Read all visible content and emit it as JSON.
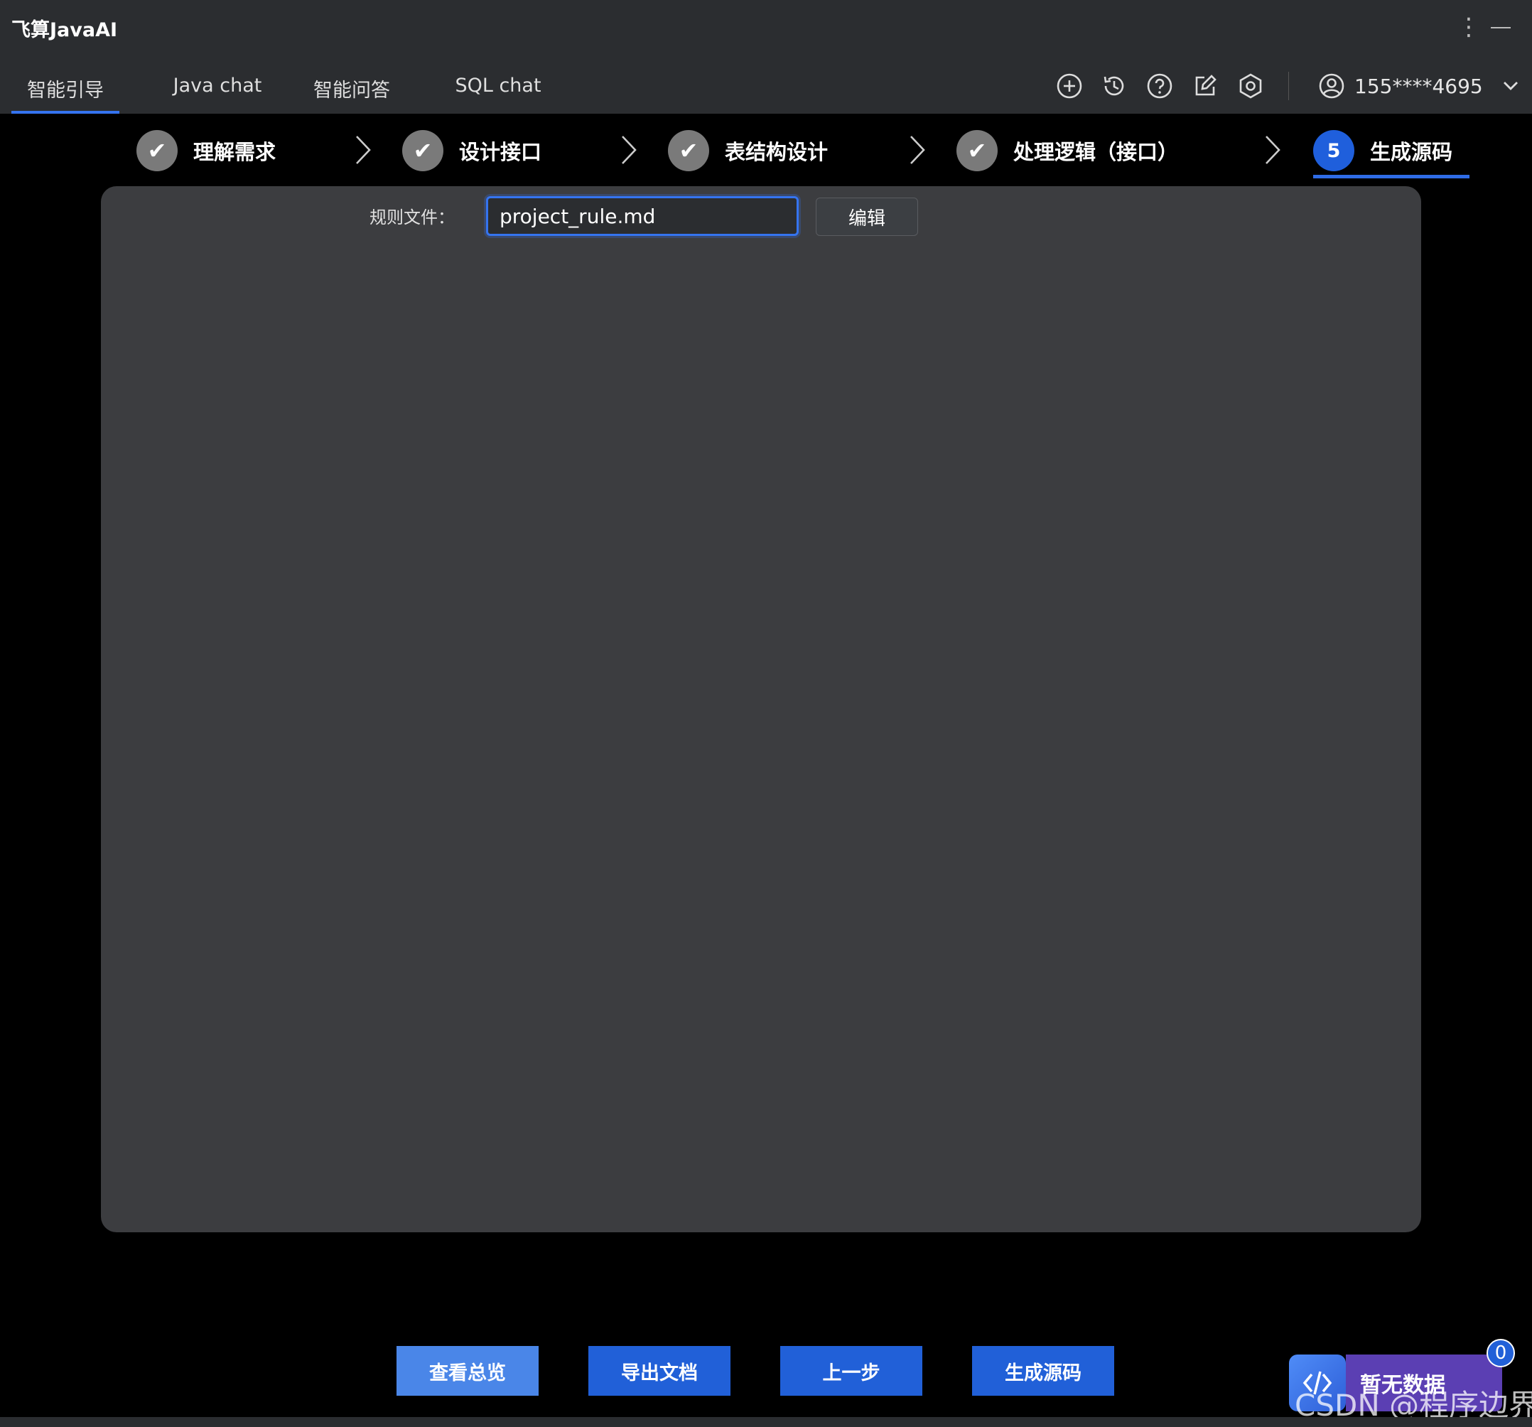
{
  "app": {
    "title": "飞算JavaAI"
  },
  "window_controls": {
    "more_icon": "more-vertical-icon",
    "minimize_icon": "minimize-icon"
  },
  "tabs": [
    {
      "label": "智能引导",
      "active": true
    },
    {
      "label": "Java chat",
      "active": false
    },
    {
      "label": "智能问答",
      "active": false
    },
    {
      "label": "SQL chat",
      "active": false
    }
  ],
  "toolbar": {
    "icons": [
      "add-circle-icon",
      "history-icon",
      "help-icon",
      "edit-icon",
      "settings-icon"
    ]
  },
  "user": {
    "phone": "155****4695",
    "icon": "user-icon",
    "dropdown_icon": "chevron-down-icon"
  },
  "steps": [
    {
      "label": "理解需求",
      "status": "done",
      "mark": "✔"
    },
    {
      "label": "设计接口",
      "status": "done",
      "mark": "✔"
    },
    {
      "label": "表结构设计",
      "status": "done",
      "mark": "✔"
    },
    {
      "label": "处理逻辑（接口）",
      "status": "done",
      "mark": "✔"
    },
    {
      "label": "生成源码",
      "status": "current",
      "mark": "5"
    }
  ],
  "rule_file": {
    "label": "规则文件：",
    "value": "project_rule.md",
    "edit_label": "编辑"
  },
  "bottom_buttons": {
    "overview": "查看总览",
    "export": "导出文档",
    "previous": "上一步",
    "generate": "生成源码"
  },
  "floating": {
    "text": "暂无数据",
    "badge_count": "0",
    "icon": "code-assistant-icon"
  },
  "watermark": "CSDN @程序边界",
  "colors": {
    "accent": "#3574f0",
    "button": "#2160d8",
    "step_done": "#7a7a7a",
    "panel": "#3c3d40"
  }
}
